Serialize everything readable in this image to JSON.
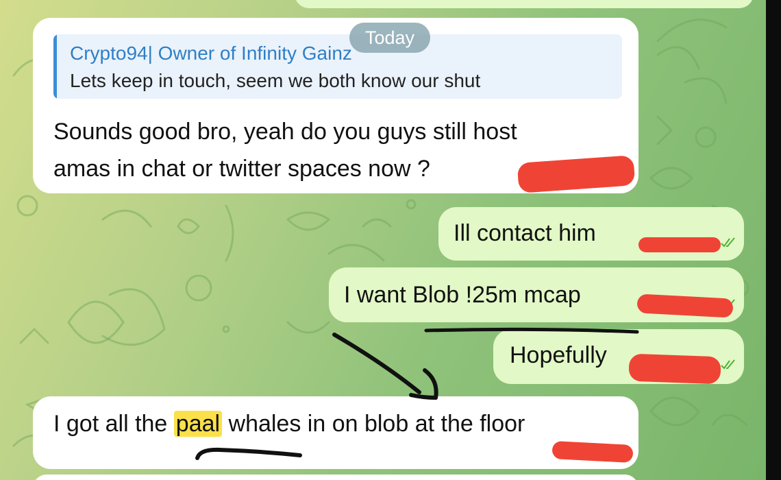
{
  "date_separator": "Today",
  "messages": {
    "reply_incoming": {
      "quote_sender": "Crypto94| Owner of Infinity Gainz",
      "quote_text": "Lets keep in touch, seem we both know our shut",
      "line1": "Sounds good bro, yeah do you guys still host",
      "line2": "amas in chat or twitter spaces now ?"
    },
    "out1": {
      "text": "Ill contact him"
    },
    "out2": {
      "text": "I want Blob !25m mcap"
    },
    "out3": {
      "text": "Hopefully"
    },
    "in2": {
      "text_before": "I got all the ",
      "highlight": "paal",
      "text_after": " whales in on blob at the floor"
    }
  },
  "icons": {
    "read_receipt": "double-check-icon",
    "background_pattern": "doodle-pattern"
  },
  "colors": {
    "incoming_bubble": "#ffffff",
    "outgoing_bubble": "#e2f8c6",
    "quote_name": "#2f7fc5",
    "check_mark": "#4fb03a",
    "redaction": "#ef4435",
    "highlight": "#fbe04a"
  }
}
